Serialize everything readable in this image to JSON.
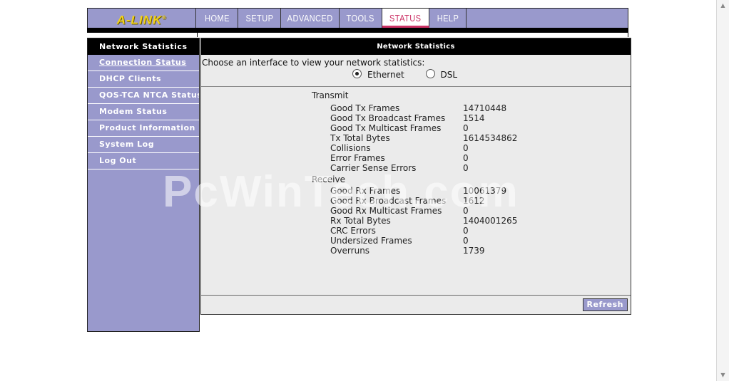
{
  "brand": {
    "logo": "A-LINK",
    "logo_mark": "®"
  },
  "nav": {
    "tabs": [
      {
        "label": "HOME"
      },
      {
        "label": "SETUP"
      },
      {
        "label": "ADVANCED"
      },
      {
        "label": "TOOLS"
      },
      {
        "label": "STATUS"
      },
      {
        "label": "HELP"
      }
    ],
    "active": "STATUS"
  },
  "sidebar": {
    "header": "Network Statistics",
    "items": [
      {
        "label": "Connection Status"
      },
      {
        "label": "DHCP Clients"
      },
      {
        "label": "QOS-TCA NTCA Status"
      },
      {
        "label": "Modem Status"
      },
      {
        "label": "Product Information"
      },
      {
        "label": "System Log"
      },
      {
        "label": "Log Out"
      }
    ]
  },
  "content": {
    "title": "Network Statistics",
    "chooser_label": "Choose an interface to view your network statistics:",
    "interfaces": [
      {
        "label": "Ethernet",
        "checked": true
      },
      {
        "label": "DSL",
        "checked": false
      }
    ],
    "transmit": {
      "title": "Transmit",
      "rows": [
        {
          "label": "Good Tx Frames",
          "value": "14710448"
        },
        {
          "label": "Good Tx Broadcast Frames",
          "value": "1514"
        },
        {
          "label": "Good Tx Multicast Frames",
          "value": "0"
        },
        {
          "label": "Tx Total Bytes",
          "value": "1614534862"
        },
        {
          "label": "Collisions",
          "value": "0"
        },
        {
          "label": "Error Frames",
          "value": "0"
        },
        {
          "label": "Carrier Sense Errors",
          "value": "0"
        }
      ]
    },
    "receive": {
      "title": "Receive",
      "rows": [
        {
          "label": "Good Rx Frames",
          "value": "10061379"
        },
        {
          "label": "Good Rx Broadcast Frames",
          "value": "1612"
        },
        {
          "label": "Good Rx Multicast Frames",
          "value": "0"
        },
        {
          "label": "Rx Total Bytes",
          "value": "1404001265"
        },
        {
          "label": "CRC Errors",
          "value": "0"
        },
        {
          "label": "Undersized Frames",
          "value": "0"
        },
        {
          "label": "Overruns",
          "value": "1739"
        }
      ]
    },
    "refresh_label": "Refresh"
  },
  "watermark": "PcWinTech.com",
  "colors": {
    "accent": "#9999cc",
    "active_tab": "#cc3366",
    "logo": "#f2d21b",
    "panel": "#ebebeb"
  }
}
